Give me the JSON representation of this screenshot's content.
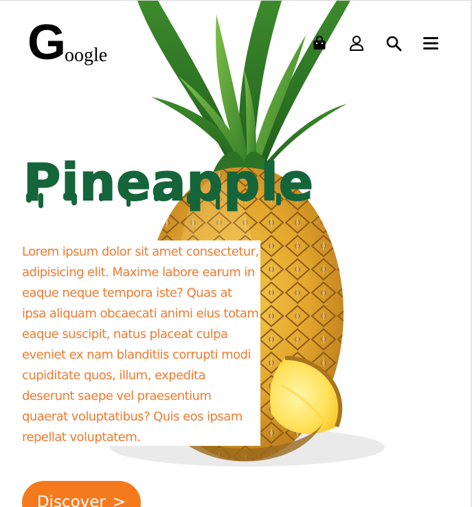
{
  "header": {
    "logo": {
      "initial": "G",
      "rest": "oogle"
    },
    "icons": [
      "shopping-bag-icon",
      "user-icon",
      "search-icon",
      "menu-icon"
    ]
  },
  "hero": {
    "title": "Pineapple",
    "description": "Lorem ipsum dolor sit amet consectetur, adipisicing elit. Maxime labore earum in eaque neque tempora iste? Quas at ipsa aliquam obcaecati animi eius totam eaque suscipit, natus placeat culpa eveniet ex nam blanditiis corrupti modi cupiditate quos, illum, expedita deserunt saepe vel praesentium quaerat voluptatibus? Quis eos ipsam repellat voluptatem.",
    "cta": {
      "label": "Discover",
      "arrow": ">"
    }
  },
  "colors": {
    "title": "#15653a",
    "description": "#f07a2f",
    "cta_bg": "#f57a1e",
    "cta_text": "#ffffff"
  }
}
